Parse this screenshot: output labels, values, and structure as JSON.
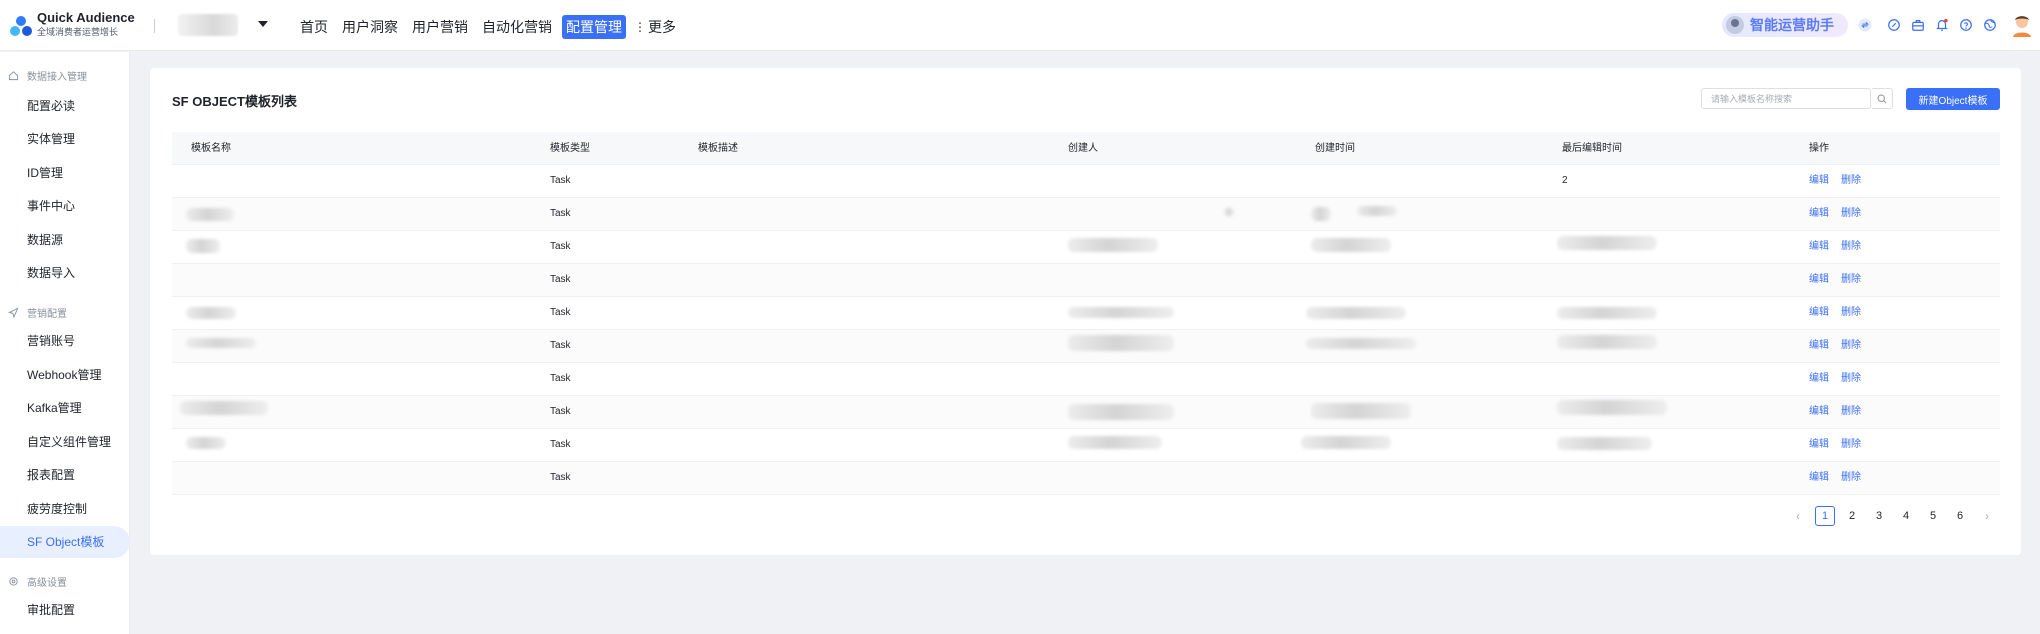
{
  "app": {
    "brand_title": "Quick Audience",
    "brand_subtitle": "全域消费者运营增长"
  },
  "nav": {
    "items": [
      "首页",
      "用户洞察",
      "用户营销",
      "自动化营销",
      "配置管理"
    ],
    "active": "配置管理",
    "more_label": "更多"
  },
  "toolbar": {
    "assistant_label": "智能运营助手",
    "icons": [
      "switch-icon",
      "link-icon",
      "briefcase-icon",
      "bell-icon",
      "help-icon",
      "globe-icon"
    ]
  },
  "sidebar": {
    "group1": "数据接入管理",
    "group1_items": [
      "配置必读",
      "实体管理",
      "ID管理",
      "事件中心",
      "数据源",
      "数据导入"
    ],
    "group2": "营销配置",
    "group2_items": [
      "营销账号",
      "Webhook管理",
      "Kafka管理",
      "自定义组件管理",
      "报表配置",
      "疲劳度控制",
      "SF Object模板"
    ],
    "group3": "高级设置",
    "group3_items": [
      "审批配置"
    ],
    "active": "SF Object模板"
  },
  "page": {
    "title": "SF OBJECT模板列表",
    "search_placeholder": "请输入模板名称搜索",
    "new_button": "新建Object模板"
  },
  "table": {
    "columns": [
      "模板名称",
      "模板类型",
      "模板描述",
      "创建人",
      "创建时间",
      "最后编辑时间",
      "操作"
    ],
    "rows": [
      {
        "type": "Task",
        "last_edit": "2"
      },
      {
        "type": "Task",
        "last_edit": ""
      },
      {
        "type": "Task",
        "last_edit": ""
      },
      {
        "type": "Task",
        "last_edit": ""
      },
      {
        "type": "Task",
        "last_edit": ""
      },
      {
        "type": "Task",
        "last_edit": ""
      },
      {
        "type": "Task",
        "last_edit": ""
      },
      {
        "type": "Task",
        "last_edit": ""
      },
      {
        "type": "Task",
        "last_edit": ""
      },
      {
        "type": "Task",
        "last_edit": ""
      }
    ],
    "actions": [
      "编辑",
      "删除"
    ]
  },
  "pagination": {
    "pages": [
      "1",
      "2",
      "3",
      "4",
      "5",
      "6"
    ],
    "current": "1",
    "prev": "‹",
    "next": "›"
  },
  "colors": {
    "primary": "#3a6ff7",
    "background": "#f0f1f5",
    "sidebar_active_bg": "#e8efff"
  }
}
